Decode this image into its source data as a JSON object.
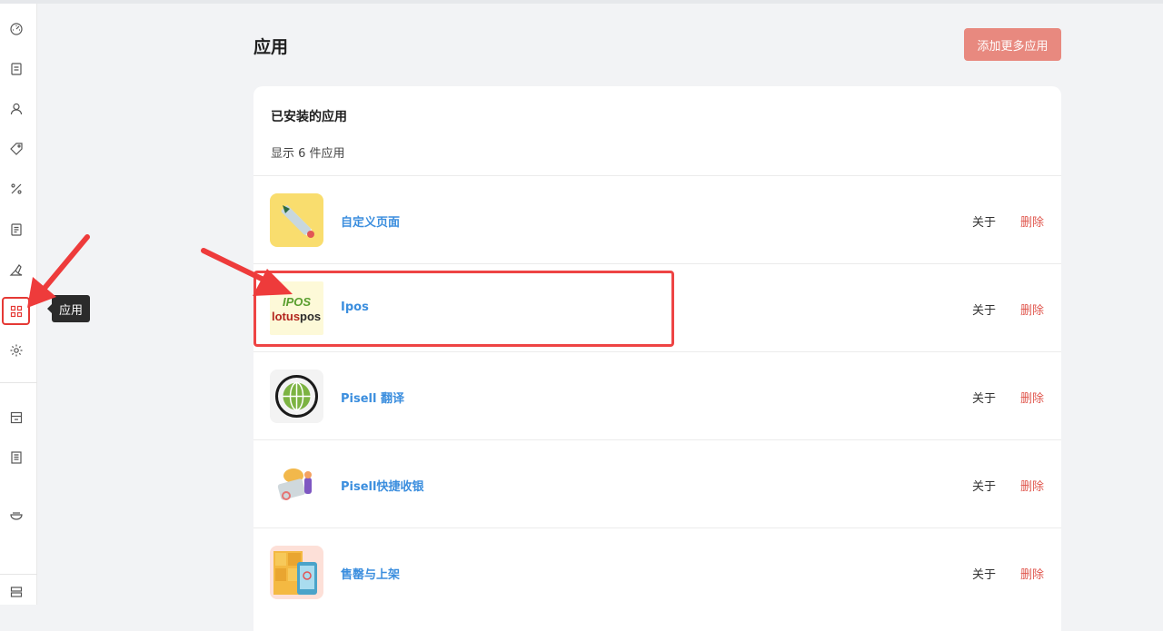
{
  "page": {
    "title": "应用",
    "add_button_label": "添加更多应用"
  },
  "sidebar": {
    "items": [
      {
        "icon": "dashboard-icon"
      },
      {
        "icon": "orders-icon"
      },
      {
        "icon": "user-icon"
      },
      {
        "icon": "tag-icon"
      },
      {
        "icon": "percent-icon"
      },
      {
        "icon": "report-icon"
      },
      {
        "icon": "brush-icon"
      },
      {
        "icon": "apps-icon",
        "active": true
      },
      {
        "icon": "gear-icon"
      },
      {
        "icon": "store-icon"
      },
      {
        "icon": "document-icon"
      },
      {
        "icon": "bowl-icon"
      },
      {
        "icon": "collapse-icon"
      }
    ],
    "tooltip": "应用"
  },
  "card": {
    "title": "已安装的应用",
    "subtitle": "显示 6 件应用"
  },
  "apps": [
    {
      "name": "自定义页面",
      "about": "关于",
      "delete": "删除",
      "logo": "ruler-pencil-logo"
    },
    {
      "name": "Ipos",
      "about": "关于",
      "delete": "删除",
      "logo": "lotuspos-logo",
      "logo_top": "IPOS",
      "logo_bottom_a": "lotus",
      "logo_bottom_b": "pos"
    },
    {
      "name": "Pisell 翻译",
      "about": "关于",
      "delete": "删除",
      "logo": "globe-logo"
    },
    {
      "name": "Pisell快捷收银",
      "about": "关于",
      "delete": "删除",
      "logo": "cashier-logo"
    },
    {
      "name": "售罄与上架",
      "about": "关于",
      "delete": "删除",
      "logo": "shelf-logo"
    }
  ],
  "colors": {
    "accent": "#e8897f",
    "link": "#3b8ede",
    "delete": "#e0584f",
    "highlight": "#ee4444"
  }
}
